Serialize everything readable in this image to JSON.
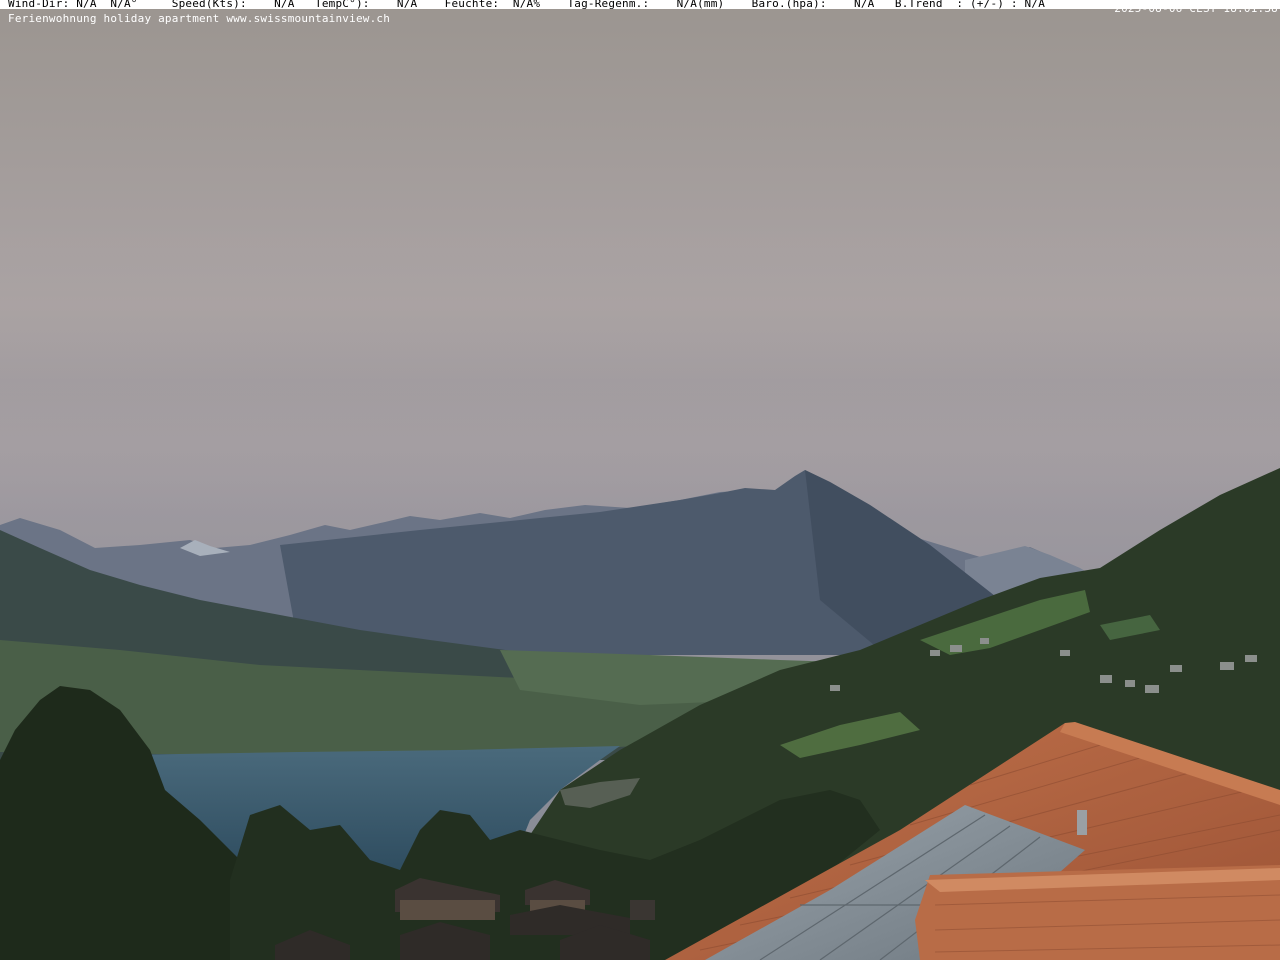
{
  "overlay": {
    "weather_line": "Wind-Dir: N/A  N/A°     Speed(Kts):    N/A   TempC°):    N/A    Feuchte:  N/A%    Tag-Regenm.:    N/A(mm)    Baro.(hpa):    N/A   B.Trend  : (+/-) : N/A",
    "timestamp": "2025-08-06 CEST 18:01:38",
    "caption": "Ferienwohnung holiday apartment www.swissmountainview.ch"
  },
  "scene": {
    "colors": {
      "sky_top": "#9c9894",
      "sky_mid": "#a7a0a0",
      "sky_haze": "#8d8d95",
      "far_mountains": "#6b7486",
      "main_peak": "#4d5a6c",
      "lake": "#3c5c70",
      "forest": "#23301f",
      "slope_green": "#3d5a34",
      "roof_tiles": "#b3643f",
      "solar_panel": "#8a949c"
    },
    "icons": [
      "sky",
      "mountain-peak",
      "lake",
      "forest",
      "village",
      "tiled-roof",
      "solar-panels"
    ]
  }
}
